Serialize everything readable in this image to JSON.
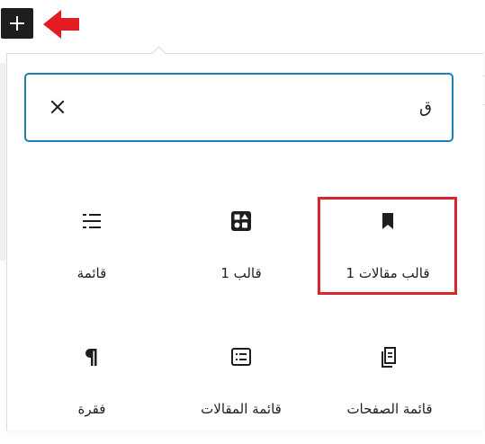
{
  "toolbar": {
    "add_block_tooltip": "Add block"
  },
  "search": {
    "value": "ق"
  },
  "blocks": [
    {
      "label": "قالب مقالات 1",
      "icon": "bookmark-icon"
    },
    {
      "label": "قالب 1",
      "icon": "shapes-pattern-icon"
    },
    {
      "label": "قائمة",
      "icon": "list-icon"
    },
    {
      "label": "قائمة الصفحات",
      "icon": "pages-icon"
    },
    {
      "label": "قائمة المقالات",
      "icon": "post-list-icon"
    },
    {
      "label": "فقرة",
      "icon": "paragraph-icon"
    }
  ],
  "colors": {
    "accent": "#1f7fb4",
    "highlight": "#d9252b",
    "arrow": "#e31b23",
    "dark": "#1e1e1e"
  }
}
